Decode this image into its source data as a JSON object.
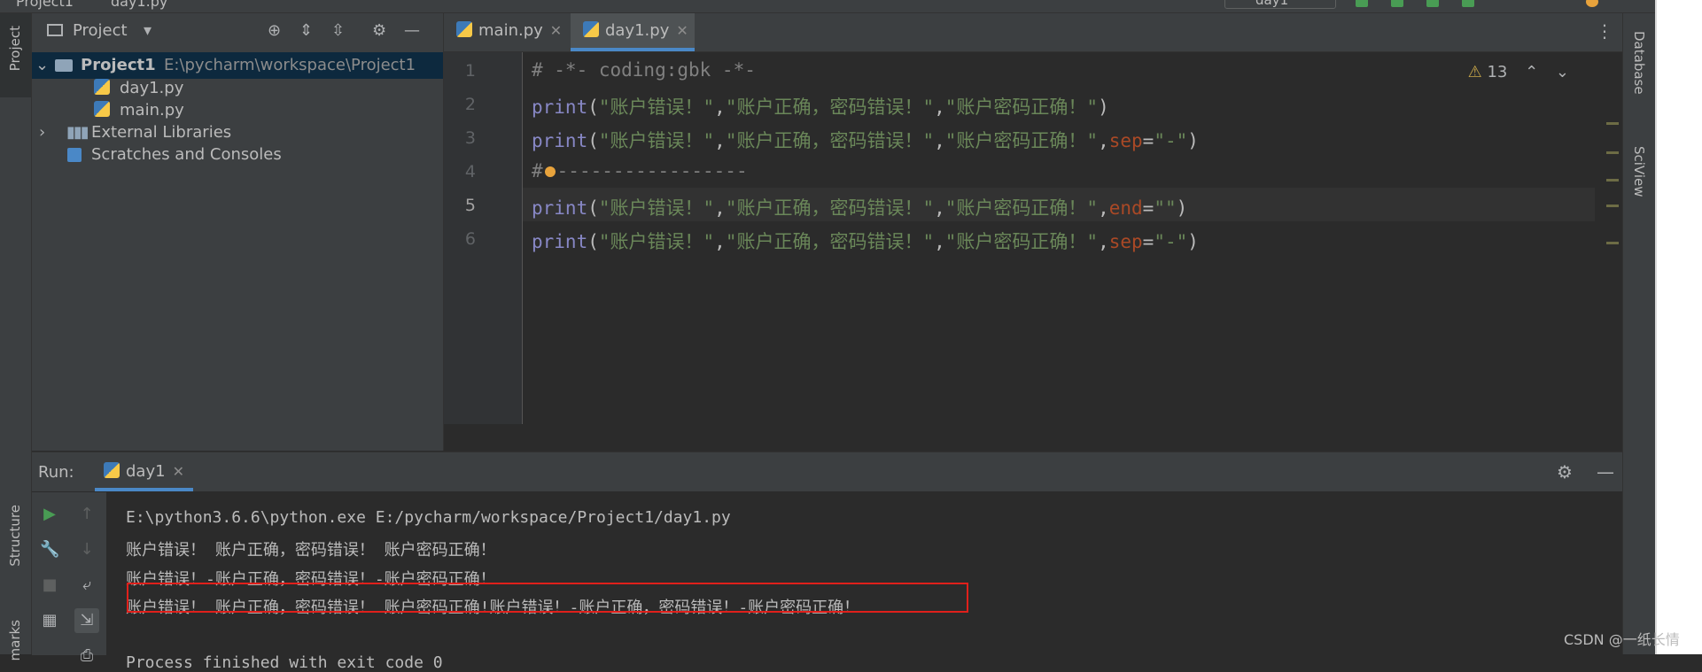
{
  "topbar": {
    "crumb_project": "Project1",
    "crumb_file": "day1.py",
    "run_config": "day1"
  },
  "left_strip": {
    "project_label": "Project",
    "structure_label": "Structure",
    "bookmarks_label": "marks"
  },
  "right_strip": {
    "database_label": "Database",
    "sciview_label": "SciView"
  },
  "project_panel": {
    "title": "Project",
    "tree": [
      {
        "label": "Project1",
        "path": "E:\\pycharm\\workspace\\Project1",
        "selected": true
      },
      {
        "label": "day1.py"
      },
      {
        "label": "main.py"
      },
      {
        "label": "External Libraries"
      },
      {
        "label": "Scratches and Consoles"
      }
    ]
  },
  "editor": {
    "tabs": [
      {
        "label": "main.py",
        "active": false
      },
      {
        "label": "day1.py",
        "active": true
      }
    ],
    "inspection_count": "13",
    "line_numbers": [
      "1",
      "2",
      "3",
      "4",
      "5",
      "6"
    ],
    "lines": {
      "l1": "# -*- coding:gbk -*-",
      "print": "print",
      "s1": "\"账户错误！\"",
      "s2": "\"账户正确，密码错误！\"",
      "s3": "\"账户密码正确！\"",
      "comma": ",",
      "sep": "sep",
      "end": "end",
      "eq": "=",
      "dash": "\"-\"",
      "empty": "\"\"",
      "lp": "(",
      "rp": ")",
      "l4_hash": "#",
      "l4_rest": "-----------------"
    }
  },
  "run": {
    "label": "Run:",
    "tab": "day1",
    "console": [
      "E:\\python3.6.6\\python.exe E:/pycharm/workspace/Project1/day1.py",
      "账户错误！ 账户正确，密码错误！ 账户密码正确！",
      "账户错误！-账户正确，密码错误！-账户密码正确！",
      "账户错误！ 账户正确，密码错误！ 账户密码正确!账户错误！-账户正确，密码错误！-账户密码正确！",
      "",
      "Process finished with exit code 0"
    ]
  },
  "watermark": "CSDN @一纸长情",
  "colors": {
    "string": "#6a8759",
    "builtin": "#8888c6",
    "kwarg": "#aa4926",
    "comment": "#808080",
    "annotation_box": "#e0201b"
  },
  "icons": [
    "python-file-icon",
    "folder-icon",
    "library-icon",
    "scratch-icon",
    "gear-icon",
    "minimize-icon",
    "play-icon",
    "wrench-icon",
    "stop-icon",
    "warning-icon"
  ]
}
